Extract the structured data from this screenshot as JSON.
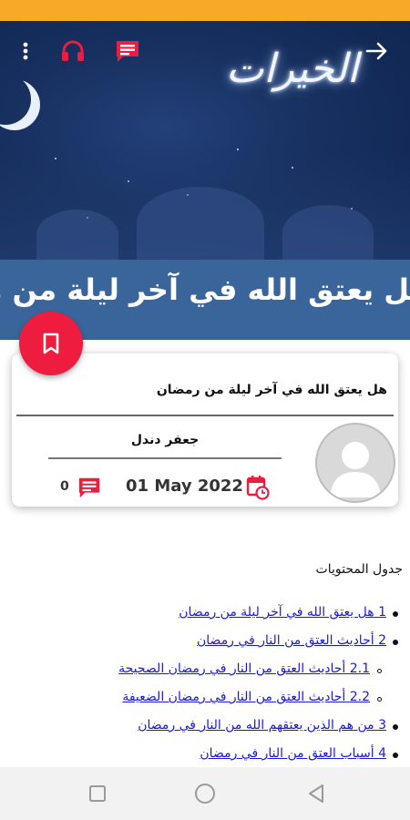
{
  "hero": {
    "calligraphy_text": "الخيرات"
  },
  "article": {
    "title_banner": "هل يعتق الله في آخر ليلة من رمضان",
    "question": "هل يعتق الله في آخر ليلة من رمضان",
    "author": "جعفر دندل",
    "date": "01 May 2022",
    "comment_count": "0"
  },
  "toc": {
    "title": "جدول المحتويات",
    "items": [
      {
        "num": "1",
        "text": "هل يعتق الله في آخر ليلة من رمضان"
      },
      {
        "num": "2",
        "text": "أحاديث العتق من النار في رمضان"
      },
      {
        "num": "2.1",
        "text": "أحاديث العتق من النار في رمضان الصحيحة"
      },
      {
        "num": "2.2",
        "text": "أحاديث العتق من النار في رمضان الضعيفة"
      },
      {
        "num": "3",
        "text": "من هم الذين يعتقهم الله من النار في رمضان"
      },
      {
        "num": "4",
        "text": "أسباب العتق من النار في رمضان"
      }
    ]
  },
  "colors": {
    "status_bar": "#f7a928",
    "accent_red": "#ee1c3e",
    "title_band": "#3a659a",
    "link_blue": "#1a1ad6"
  },
  "icons": [
    "more-vert-icon",
    "headphones-icon",
    "comment-icon",
    "forward-arrow-icon",
    "bookmark-icon",
    "calendar-icon",
    "avatar-placeholder-icon",
    "recents-square-icon",
    "home-circle-icon",
    "back-triangle-icon"
  ]
}
